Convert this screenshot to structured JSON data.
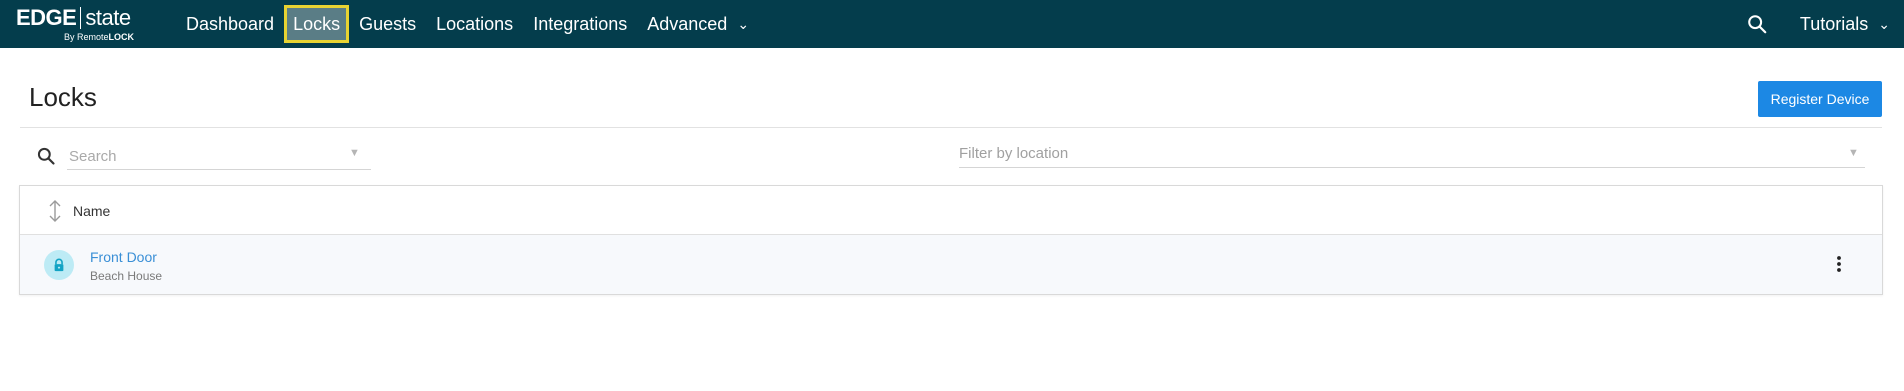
{
  "app": {
    "logo_primary": "EDGE",
    "logo_secondary": "state",
    "logo_sub_prefix": "By Remote",
    "logo_sub_brand": "LOCK"
  },
  "nav": {
    "items": [
      {
        "label": "Dashboard"
      },
      {
        "label": "Locks",
        "active": true
      },
      {
        "label": "Guests"
      },
      {
        "label": "Locations"
      },
      {
        "label": "Integrations"
      },
      {
        "label": "Advanced",
        "has_dropdown": true
      }
    ],
    "right": {
      "search_icon": "search-icon",
      "tutorials_label": "Tutorials"
    }
  },
  "page": {
    "title": "Locks",
    "register_button": "Register Device"
  },
  "filters": {
    "search_placeholder": "Search",
    "location_placeholder": "Filter by location"
  },
  "table": {
    "columns": [
      {
        "label": "Name",
        "sortable": true
      }
    ],
    "rows": [
      {
        "name": "Front Door",
        "location": "Beach House",
        "icon": "lock-icon"
      }
    ]
  },
  "colors": {
    "topbar": "#043d4c",
    "accent": "#1c88e4",
    "active_highlight": "#e8d332",
    "link": "#3a8fd6"
  }
}
